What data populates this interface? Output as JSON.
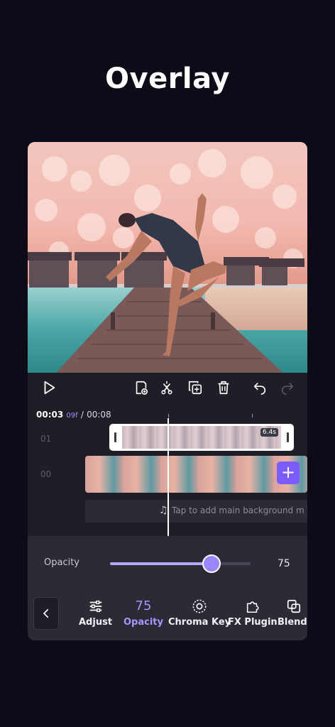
{
  "header": {
    "title": "Overlay"
  },
  "timeline": {
    "current_time": "00:03",
    "current_frames": "09f",
    "separator": "/",
    "total_time": "00:08",
    "track_overlay_label": "01",
    "track_main_label": "00",
    "overlay_duration": "6.4s",
    "bg_track_text": "Tap to add main background m"
  },
  "opacity": {
    "label": "Opacity",
    "value": "75",
    "level": 0.75
  },
  "tools": [
    {
      "label": "Adjust",
      "icon": "sliders-icon"
    },
    {
      "label": "Opacity",
      "value": "75",
      "icon": "opacity-value"
    },
    {
      "label": "Chroma Key",
      "icon": "chroma-key-icon"
    },
    {
      "label": "FX Plugin",
      "icon": "puzzle-icon"
    },
    {
      "label": "Blendi",
      "icon": "blending-icon"
    }
  ],
  "colors": {
    "accent": "#7b5cff",
    "slider_fill": "#b7a6ff",
    "background": "#0c0b17",
    "panel": "#2b2a35"
  }
}
